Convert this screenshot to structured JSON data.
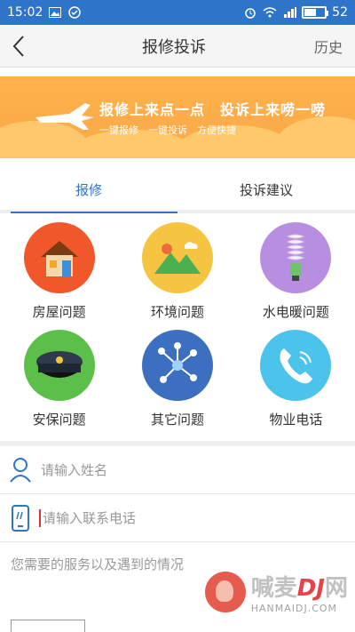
{
  "status_bar": {
    "time": "15:02",
    "battery": "52",
    "battery_level": 0.52
  },
  "navbar": {
    "back_icon": "back-arrow-icon",
    "title": "报修投诉",
    "right_label": "历史"
  },
  "banner": {
    "main_text": "报修上来点一点　投诉上来唠一唠",
    "sub_text": "一键报修　一键投诉　方便快捷",
    "colors": {
      "bg": "#ffb24a",
      "cloud": "#ffc86a"
    }
  },
  "tabs": [
    {
      "label": "报修",
      "active": true
    },
    {
      "label": "投诉建议",
      "active": false
    }
  ],
  "categories": [
    {
      "label": "房屋问题",
      "icon": "house-icon",
      "color": "#f0572b"
    },
    {
      "label": "环境问题",
      "icon": "landscape-icon",
      "color": "#f5c542"
    },
    {
      "label": "水电暖问题",
      "icon": "lightbulb-icon",
      "color": "#b88ee0"
    },
    {
      "label": "安保问题",
      "icon": "police-cap-icon",
      "color": "#5cbf4a"
    },
    {
      "label": "其它问题",
      "icon": "network-icon",
      "color": "#3d6fc0"
    },
    {
      "label": "物业电话",
      "icon": "phone-icon",
      "color": "#4bc3ea"
    }
  ],
  "form": {
    "name_placeholder": "请输入姓名",
    "phone_placeholder": "请输入联系电话",
    "desc_placeholder": "您需要的服务以及遇到的情况"
  },
  "watermark": {
    "main_prefix": "喊麦",
    "main_mid": "DJ",
    "main_suffix": "网",
    "sub": "HANMAIDJ.COM"
  },
  "accent": "#2e74c8"
}
